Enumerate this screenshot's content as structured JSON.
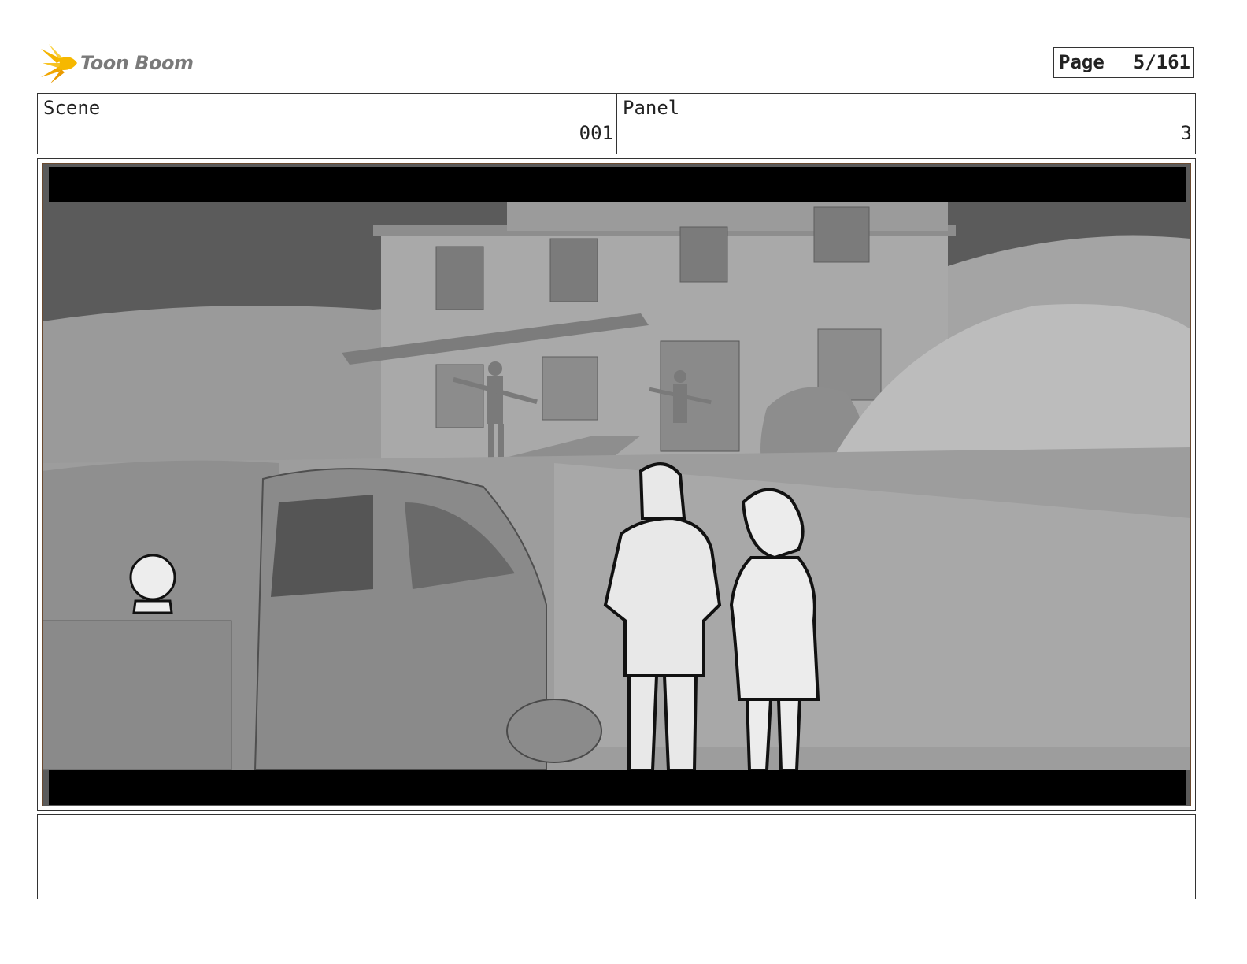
{
  "header": {
    "logo_text": "Toon Boom",
    "page_label": "Page",
    "page_number": "5/161"
  },
  "info": {
    "scene_label": "Scene",
    "scene_value": "001",
    "panel_label": "Panel",
    "panel_value": "3"
  },
  "panel_image": {
    "description_icon": "storyboard-frame-image"
  },
  "notes": {
    "text": ""
  }
}
